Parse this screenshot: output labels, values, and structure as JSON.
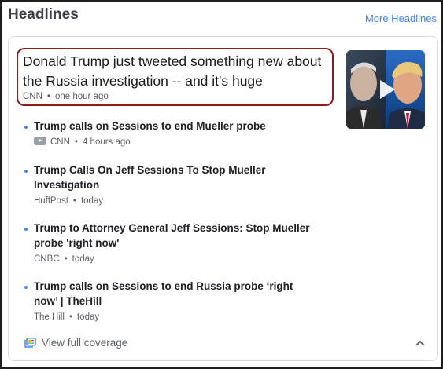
{
  "header": {
    "title": "Headlines",
    "more_link": "More Headlines"
  },
  "top_story": {
    "headline": "Donald Trump just tweeted something new about the Russia investigation -- and it's huge",
    "source": "CNN",
    "time": "one hour ago",
    "thumbnail_icon": "play-icon"
  },
  "stories": [
    {
      "title": "Trump calls on Sessions to end Mueller probe",
      "source": "CNN",
      "time": "4 hours ago",
      "source_icon": "youtube-icon"
    },
    {
      "title": "Trump Calls On Jeff Sessions To Stop Mueller Investigation",
      "source": "HuffPost",
      "time": "today"
    },
    {
      "title": "Trump to Attorney General Jeff Sessions: Stop Mueller probe 'right now'",
      "source": "CNBC",
      "time": "today"
    },
    {
      "title": "Trump calls on Sessions to end Russia probe ‘right now’ | TheHill",
      "source": "The Hill",
      "time": "today"
    }
  ],
  "footer": {
    "coverage_label": "View full coverage",
    "coverage_icon": "full-coverage-icon",
    "collapse_icon": "chevron-up-icon"
  },
  "colors": {
    "accent_blue": "#4285f4",
    "highlight_border": "#8b1c1c",
    "meta_gray": "#5f6368"
  }
}
